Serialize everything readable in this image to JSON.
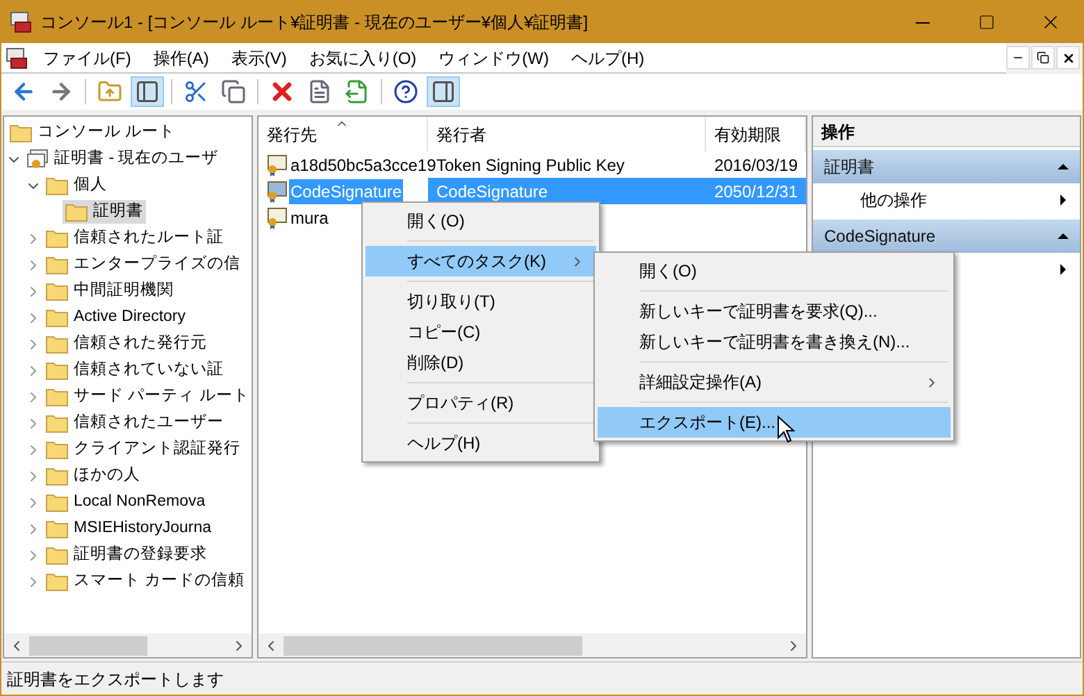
{
  "window": {
    "title": "コンソール1 - [コンソール ルート¥証明書 - 現在のユーザー¥個人¥証明書]"
  },
  "menu_bar": [
    {
      "label": "ファイル(F)"
    },
    {
      "label": "操作(A)"
    },
    {
      "label": "表示(V)"
    },
    {
      "label": "お気に入り(O)"
    },
    {
      "label": "ウィンドウ(W)"
    },
    {
      "label": "ヘルプ(H)"
    }
  ],
  "toolbar": [
    {
      "kind": "back",
      "pressed": false
    },
    {
      "kind": "forward",
      "pressed": false
    },
    {
      "kind": "sep"
    },
    {
      "kind": "up",
      "pressed": false
    },
    {
      "kind": "tree",
      "pressed": true
    },
    {
      "kind": "sep"
    },
    {
      "kind": "cut",
      "pressed": false
    },
    {
      "kind": "copy",
      "pressed": false
    },
    {
      "kind": "sep"
    },
    {
      "kind": "delete",
      "pressed": false
    },
    {
      "kind": "properties",
      "pressed": false
    },
    {
      "kind": "export",
      "pressed": false
    },
    {
      "kind": "sep"
    },
    {
      "kind": "help",
      "pressed": false
    },
    {
      "kind": "pane",
      "pressed": true
    }
  ],
  "tree": {
    "label": "コンソール ルート",
    "kind": "folder",
    "selected": false,
    "children": [
      {
        "label": "証明書 - 現在のユーザ",
        "kind": "store",
        "expanded": true,
        "selected": false,
        "children": [
          {
            "label": "個人",
            "kind": "folder",
            "expanded": true,
            "selected": false,
            "children": [
              {
                "label": "証明書",
                "kind": "folder",
                "selected": true
              }
            ]
          },
          {
            "label": "信頼されたルート証",
            "kind": "folder",
            "expanded": false,
            "selected": false
          },
          {
            "label": "エンタープライズの信",
            "kind": "folder",
            "expanded": false,
            "selected": false
          },
          {
            "label": "中間証明機関",
            "kind": "folder",
            "expanded": false,
            "selected": false
          },
          {
            "label": "Active Directory",
            "kind": "folder",
            "expanded": false,
            "selected": false
          },
          {
            "label": "信頼された発行元",
            "kind": "folder",
            "expanded": false,
            "selected": false
          },
          {
            "label": "信頼されていない証",
            "kind": "folder",
            "expanded": false,
            "selected": false
          },
          {
            "label": "サード パーティ ルート",
            "kind": "folder",
            "expanded": false,
            "selected": false
          },
          {
            "label": "信頼されたユーザー",
            "kind": "folder",
            "expanded": false,
            "selected": false
          },
          {
            "label": "クライアント認証発行",
            "kind": "folder",
            "expanded": false,
            "selected": false
          },
          {
            "label": "ほかの人",
            "kind": "folder",
            "expanded": false,
            "selected": false
          },
          {
            "label": "Local NonRemova",
            "kind": "folder",
            "expanded": false,
            "selected": false
          },
          {
            "label": "MSIEHistoryJourna",
            "kind": "folder",
            "expanded": false,
            "selected": false
          },
          {
            "label": "証明書の登録要求",
            "kind": "folder",
            "expanded": false,
            "selected": false
          },
          {
            "label": "スマート カードの信頼",
            "kind": "folder",
            "expanded": false,
            "selected": false
          }
        ]
      }
    ]
  },
  "table": {
    "columns": [
      {
        "label": "発行先",
        "sorted": true
      },
      {
        "label": "発行者",
        "sorted": false
      },
      {
        "label": "有効期限",
        "sorted": false
      }
    ],
    "rows": [
      {
        "cells": [
          "a18d50bc5a3cce19",
          "Token Signing Public Key",
          "2016/03/19"
        ],
        "kind": "cert",
        "selected": false
      },
      {
        "cells": [
          "CodeSignature",
          "CodeSignature",
          "2050/12/31"
        ],
        "kind": "selfsigned",
        "selected": true
      },
      {
        "cells": [
          "mura",
          "",
          ""
        ],
        "kind": "cert",
        "selected": false
      }
    ]
  },
  "context_menu": {
    "groups": [
      [
        {
          "label": "開く(O)",
          "selected": false,
          "submenu": false
        }
      ],
      [
        {
          "label": "すべてのタスク(K)",
          "selected": true,
          "submenu": true
        }
      ],
      [
        {
          "label": "切り取り(T)",
          "selected": false,
          "submenu": false
        },
        {
          "label": "コピー(C)",
          "selected": false,
          "submenu": false
        },
        {
          "label": "削除(D)",
          "selected": false,
          "submenu": false
        }
      ],
      [
        {
          "label": "プロパティ(R)",
          "selected": false,
          "submenu": false
        }
      ],
      [
        {
          "label": "ヘルプ(H)",
          "selected": false,
          "submenu": false
        }
      ]
    ]
  },
  "submenu": {
    "groups": [
      [
        {
          "label": "開く(O)",
          "selected": false,
          "submenu": false
        }
      ],
      [
        {
          "label": "新しいキーで証明書を要求(Q)...",
          "selected": false,
          "submenu": false
        },
        {
          "label": "新しいキーで証明書を書き換え(N)...",
          "selected": false,
          "submenu": false
        }
      ],
      [
        {
          "label": "詳細設定操作(A)",
          "selected": false,
          "submenu": true
        }
      ],
      [
        {
          "label": "エクスポート(E)...",
          "selected": true,
          "submenu": false
        }
      ]
    ]
  },
  "actions": {
    "title": "操作",
    "sections": [
      {
        "title": "証明書",
        "expanded": true,
        "items": [
          {
            "kind": "action",
            "label": "他の操作"
          }
        ]
      },
      {
        "title": "CodeSignature",
        "expanded": true,
        "items": [
          {
            "kind": "arrow_only"
          }
        ]
      }
    ]
  },
  "status_bar": {
    "text": "証明書をエクスポートします"
  }
}
